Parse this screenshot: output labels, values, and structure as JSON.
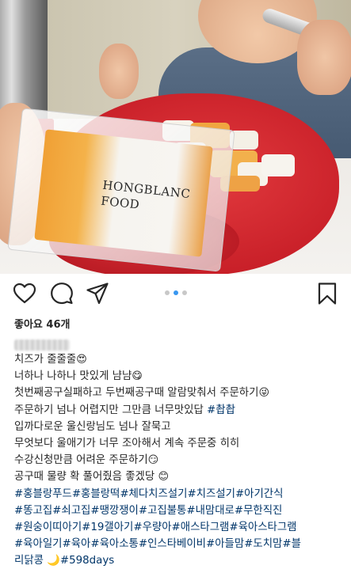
{
  "post": {
    "brand_text": "HONGBLANC\nFOOD",
    "likes": "좋아요 46개",
    "carousel": {
      "count": 3,
      "active": 1
    }
  },
  "actions": {
    "like_icon": "heart-outline-icon",
    "comment_icon": "comment-bubble-icon",
    "share_icon": "paper-plane-icon",
    "save_icon": "bookmark-outline-icon"
  },
  "caption": {
    "lines": [
      {
        "text": "치즈가 줄줄줄",
        "emoji": "😍",
        "hashtags": ""
      },
      {
        "text": "너하나 나하나 맛있게 냠냠",
        "emoji": "😋",
        "hashtags": ""
      },
      {
        "text": "첫번째공구실패하고 두번째공구때 알람맞춰서 주문하기",
        "emoji": "😜",
        "hashtags": ""
      },
      {
        "text": "주문하기 넘나 어렵지만 그만큼 너무맛있답 ",
        "emoji": "",
        "hashtags": "#촵촵"
      },
      {
        "text": "입까다로운 울신랑님도 넘나 잘묵고",
        "emoji": "",
        "hashtags": ""
      },
      {
        "text": "무엇보다 울애기가 너무 조아해서 계속 주문중 히히",
        "emoji": "",
        "hashtags": ""
      },
      {
        "text": "수강신청만큼 어려운 주문하기",
        "emoji": "😏",
        "hashtags": ""
      },
      {
        "text": "공구때 물량 확 풀어줬음 좋겠당 ",
        "emoji": "😊",
        "hashtags": ""
      },
      {
        "text": "",
        "emoji": "",
        "hashtags": "#홍블랑푸드#홍블랑떡#체다치즈설기#치즈설기#아기간식"
      },
      {
        "text": "",
        "emoji": "",
        "hashtags": "#똥고집#쇠고집#땡깡쟁이#고집불통#내맘대로#무한직진"
      },
      {
        "text": "",
        "emoji": "",
        "hashtags": "#원숭이띠아기#19갤아기#우량아#애스타그램#육아스타그램"
      },
      {
        "text": "",
        "emoji": "",
        "hashtags": "#육아일기#육아#육아소통#인스타베이비#아들맘#도치맘#블"
      },
      {
        "text": "",
        "emoji": "",
        "hashtags": "리닭콩 🌙#598days"
      }
    ]
  },
  "colors": {
    "text": "#262626",
    "hashtag": "#003569",
    "carousel_active": "#3897f0",
    "carousel_inactive": "#c8c8c8"
  }
}
